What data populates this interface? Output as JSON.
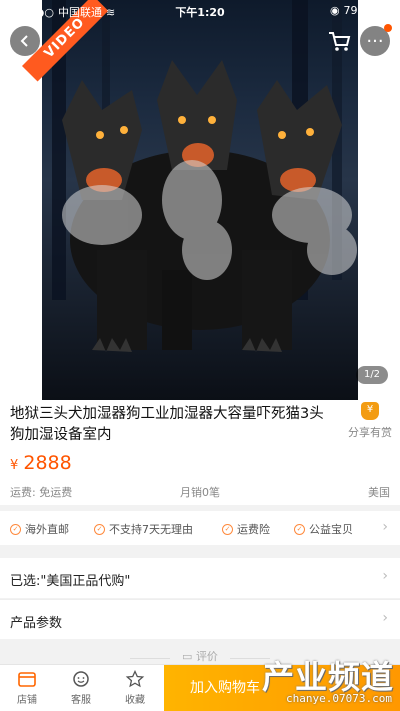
{
  "status_bar": {
    "carrier": "中国联通",
    "time": "下午1:20",
    "battery": "79%"
  },
  "hero": {
    "badge": "VIDEO",
    "page_indicator": "1/2"
  },
  "product": {
    "title": "地狱三头犬加湿器狗工业加湿器大容量吓死猫3头狗加湿设备室内",
    "share_label": "分享有赏",
    "currency": "¥",
    "price": "2888",
    "shipping": "运费: 免运费",
    "sales": "月销0笔",
    "origin": "美国"
  },
  "services": [
    {
      "label": "海外直邮"
    },
    {
      "label": "不支持7天无理由"
    },
    {
      "label": "运费险"
    },
    {
      "label": "公益宝贝"
    }
  ],
  "rows": {
    "selected": "已选:\"美国正品代购\"",
    "params": "产品参数"
  },
  "review_hint": "评价",
  "bottom_bar": {
    "store": "店铺",
    "service": "客服",
    "favorite": "收藏",
    "add_to_cart": "加入购物车"
  },
  "watermark": {
    "text": "产业频道",
    "url": "chanye.07073.com"
  },
  "colors": {
    "accent": "#ff5500",
    "buy_button": "#ff9800",
    "badge": "#ff5a1f"
  }
}
